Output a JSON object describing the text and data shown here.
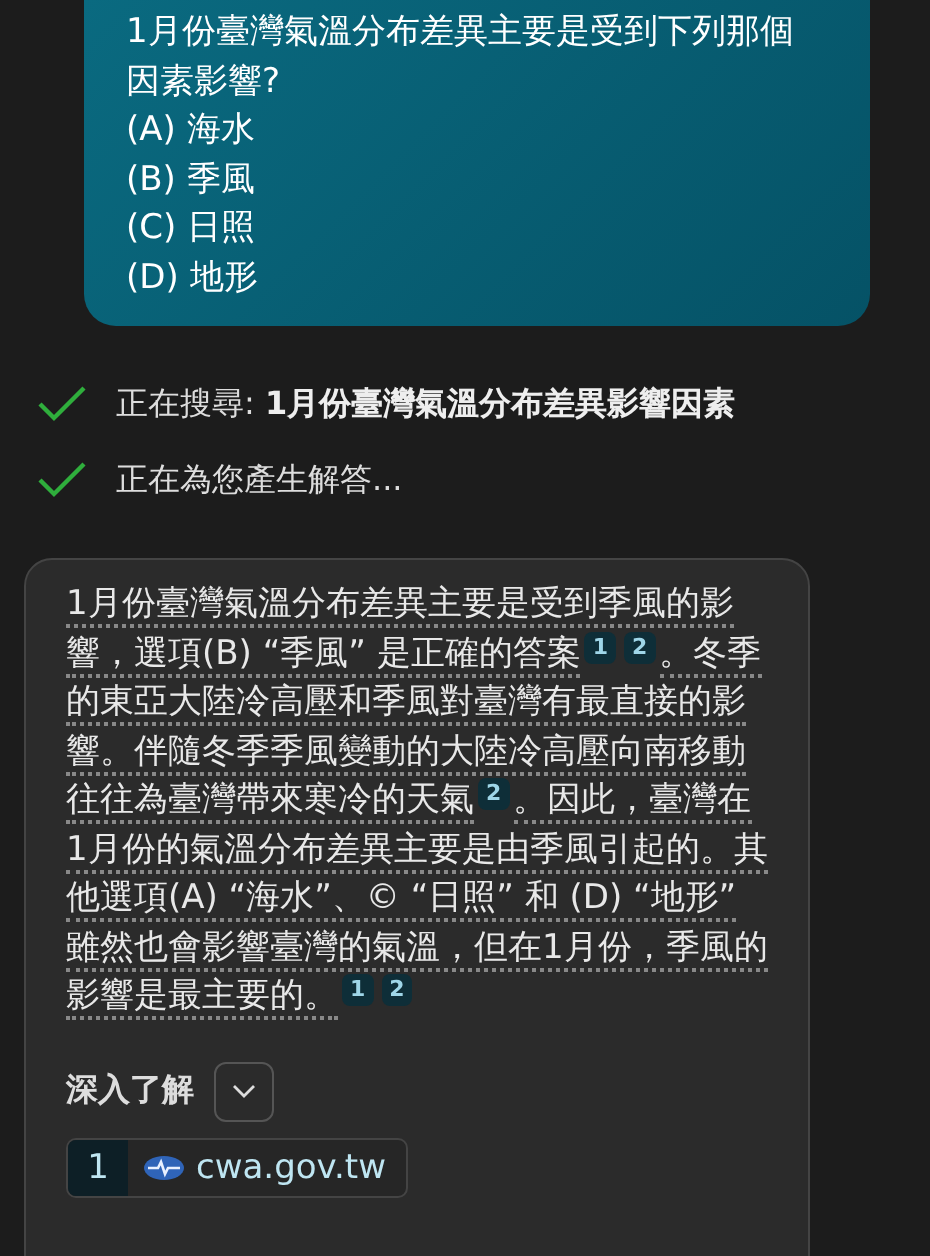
{
  "question": {
    "lines": [
      "1月份臺灣氣溫分布差異主要是受到下列那個因素影響?",
      "(A) 海水",
      "(B) 季風",
      "(C) 日照",
      "(D) 地形"
    ]
  },
  "progress": [
    {
      "label": "正在搜尋: ",
      "query": "1月份臺灣氣溫分布差異影響因素",
      "done": true
    },
    {
      "label": "正在為您產生解答...",
      "done": true
    }
  ],
  "answer": {
    "segments": [
      {
        "text": "1月份臺灣氣溫分布差異主要是受到季風的影響，選項(B) “季風” 是正確的答案",
        "citations": [
          "1",
          "2"
        ]
      },
      {
        "text": "。冬季的東亞大陸冷高壓和季風對臺灣有最直接的影響。伴隨冬季季風變動的大陸冷高壓向南移動往往為臺灣帶來寒冷的天氣",
        "citations": [
          "2"
        ]
      },
      {
        "text": "。因此，臺灣在1月份的氣溫分布差異主要是由季風引起的。其他選項(A) “海水”、© “日照” 和 (D) “地形” 雖然也會影響臺灣的氣溫，但在1月份，季風的影響是最主要的。",
        "citations": [
          "1",
          "2"
        ]
      }
    ],
    "learn_more": {
      "label": "深入了解",
      "expanded": false
    },
    "sources": [
      {
        "number": "1",
        "site": "cwa.gov.tw"
      }
    ]
  }
}
